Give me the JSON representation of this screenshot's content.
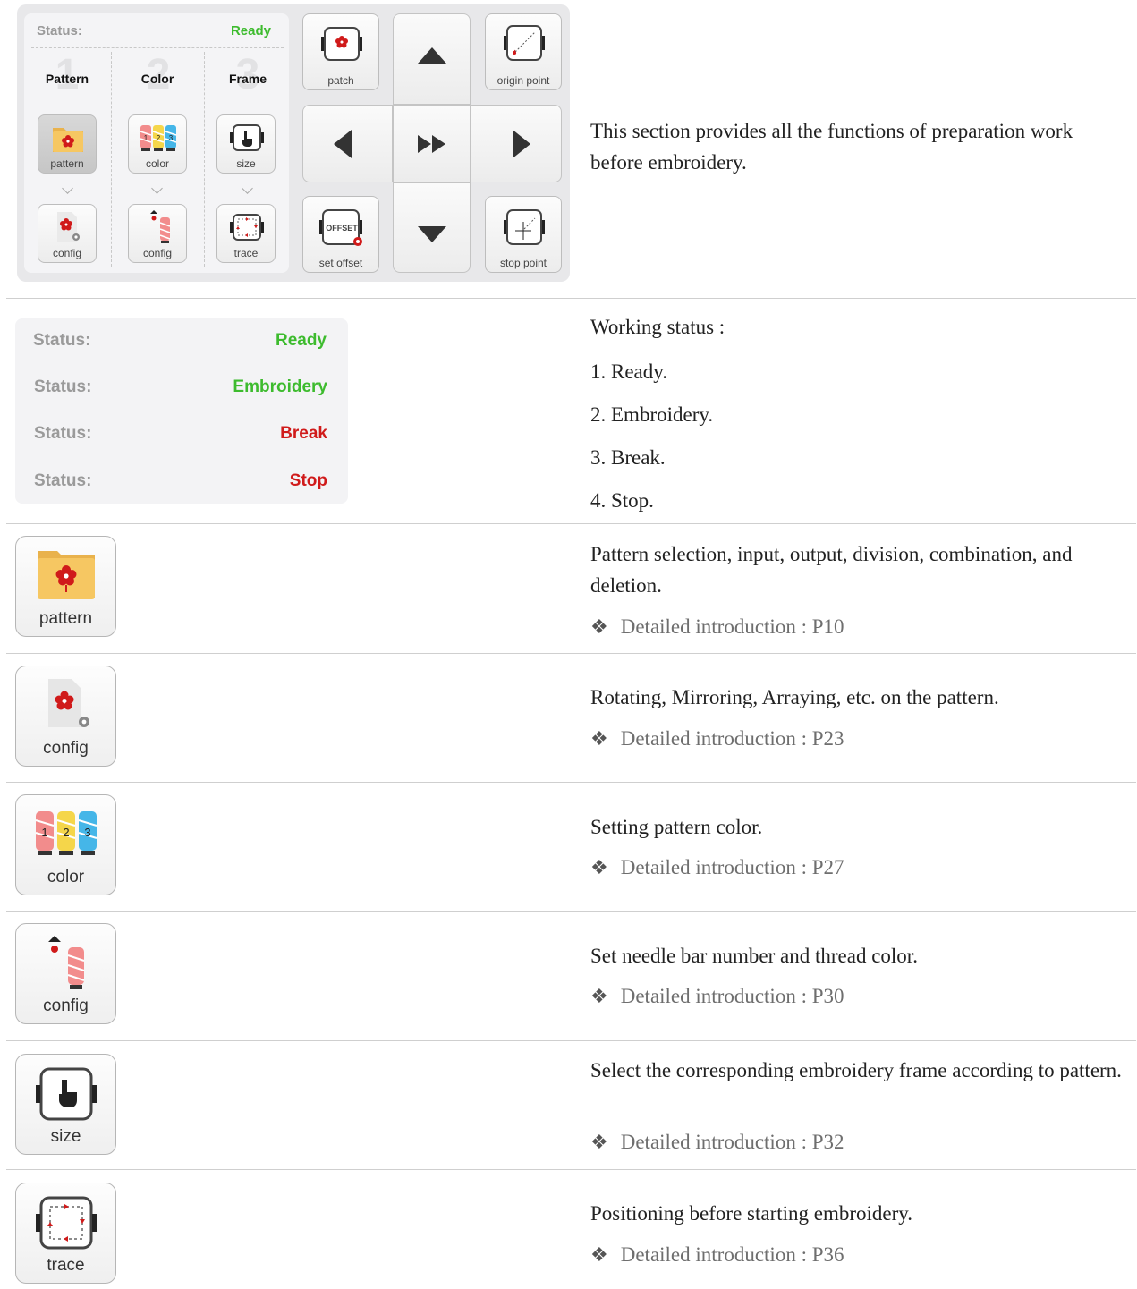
{
  "panel": {
    "status_key": "Status:",
    "status_value": "Ready",
    "steps": [
      {
        "num": "1",
        "label": "Pattern"
      },
      {
        "num": "2",
        "label": "Color"
      },
      {
        "num": "3",
        "label": "Frame"
      }
    ],
    "buttons": {
      "pattern": "pattern",
      "color": "color",
      "size": "size",
      "config1": "config",
      "config2": "config",
      "trace": "trace",
      "patch": "patch",
      "origin": "origin point",
      "set_offset": "set offset",
      "stop_point": "stop point",
      "offset_tag": "OFFSET"
    }
  },
  "intro": "This section provides all the functions of preparation work before embroidery.",
  "status_list": {
    "rows": [
      {
        "key": "Status:",
        "value": "Ready",
        "color": "#3dbb2e"
      },
      {
        "key": "Status:",
        "value": "Embroidery",
        "color": "#3dbb2e"
      },
      {
        "key": "Status:",
        "value": "Break",
        "color": "#d01a1a"
      },
      {
        "key": "Status:",
        "value": "Stop",
        "color": "#d01a1a"
      }
    ],
    "heading": "Working status :",
    "items": [
      "1. Ready.",
      "2. Embroidery.",
      "3. Break.",
      "4. Stop."
    ]
  },
  "features": [
    {
      "button": "pattern",
      "desc": "Pattern selection, input, output, division, combination, and deletion.",
      "ref": "Detailed introduction :  P10"
    },
    {
      "button": "config",
      "desc": "Rotating, Mirroring, Arraying, etc. on the pattern.",
      "ref": "Detailed introduction :  P23"
    },
    {
      "button": "color",
      "desc": "Setting pattern color.",
      "ref": "Detailed introduction :  P27"
    },
    {
      "button": "config",
      "desc": "Set needle bar number and thread color.",
      "ref": "Detailed introduction :  P30"
    },
    {
      "button": "size",
      "desc": "Select the corresponding embroidery frame according to pattern.",
      "ref": "Detailed introduction :  P32"
    },
    {
      "button": "trace",
      "desc": "Positioning before starting embroidery.",
      "ref": "Detailed introduction :  P36"
    }
  ],
  "ref_bullet": "❖",
  "colors": {
    "ready": "#3dbb2e",
    "stop": "#d01a1a",
    "folder": "#f3c461",
    "flower": "#d01a1a"
  }
}
